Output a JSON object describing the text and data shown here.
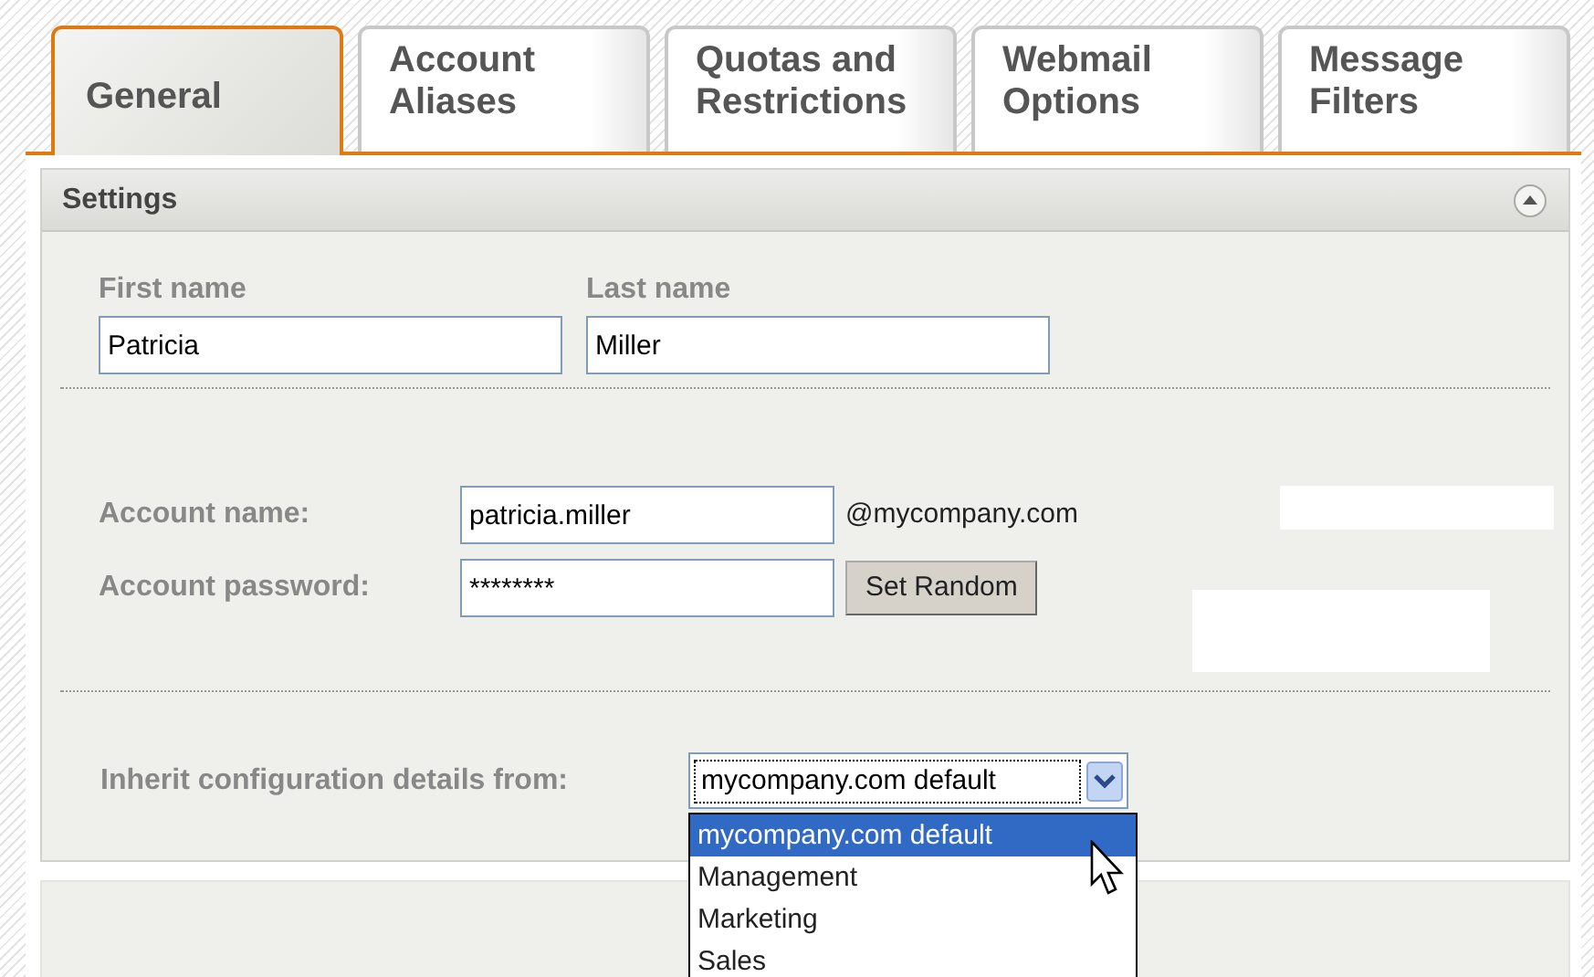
{
  "tabs": [
    {
      "label": "General",
      "selected": true
    },
    {
      "label": "Account Aliases",
      "selected": false
    },
    {
      "label": "Quotas and Restrictions",
      "selected": false
    },
    {
      "label": "Webmail Options",
      "selected": false
    },
    {
      "label": "Message Filters",
      "selected": false
    }
  ],
  "section": {
    "title": "Settings",
    "expanded": true
  },
  "name_fields": [
    {
      "label": "First name",
      "value": "Patricia"
    },
    {
      "label": "Last name",
      "value": "Miller"
    }
  ],
  "account": {
    "name_label": "Account name:",
    "name_value": "patricia.miller",
    "domain": "@mycompany.com",
    "password_label": "Account password:",
    "password_value": "********",
    "random_button": "Set Random"
  },
  "inherit": {
    "label": "Inherit configuration details from:",
    "value": "mycompany.com default",
    "expanded": true,
    "options": [
      {
        "label": "mycompany.com default",
        "selected": true
      },
      {
        "label": "Management",
        "selected": false
      },
      {
        "label": "Marketing",
        "selected": false
      },
      {
        "label": "Sales",
        "selected": false
      }
    ]
  }
}
